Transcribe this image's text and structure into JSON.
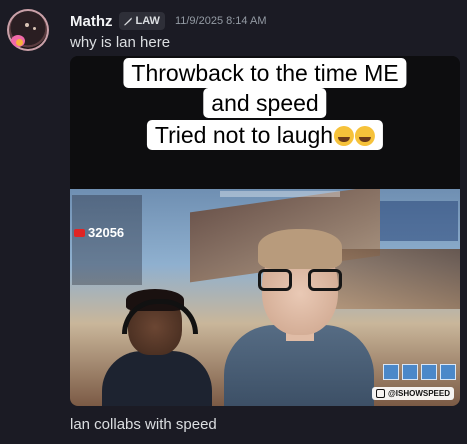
{
  "message": {
    "author": "Mathz",
    "role_tag": "LAW",
    "timestamp": "11/9/2025 8:14 AM",
    "text": "why is lan here",
    "followup_text": "lan collabs with speed"
  },
  "media": {
    "caption_lines": [
      "Throwback to the time ME",
      "and speed",
      "Tried not to laugh"
    ],
    "overlay": {
      "subscriber_count": "32056",
      "watermark": "@ISHOWSPEED"
    }
  },
  "icons": {
    "role": "quill-pen-icon",
    "emoji": "laughing-emoji-icon",
    "play": "youtube-play-icon",
    "instagram": "instagram-icon"
  },
  "colors": {
    "background": "#1b1b24",
    "text": "#dbdee1",
    "muted": "#949ba4",
    "username": "#f2f3f5"
  }
}
